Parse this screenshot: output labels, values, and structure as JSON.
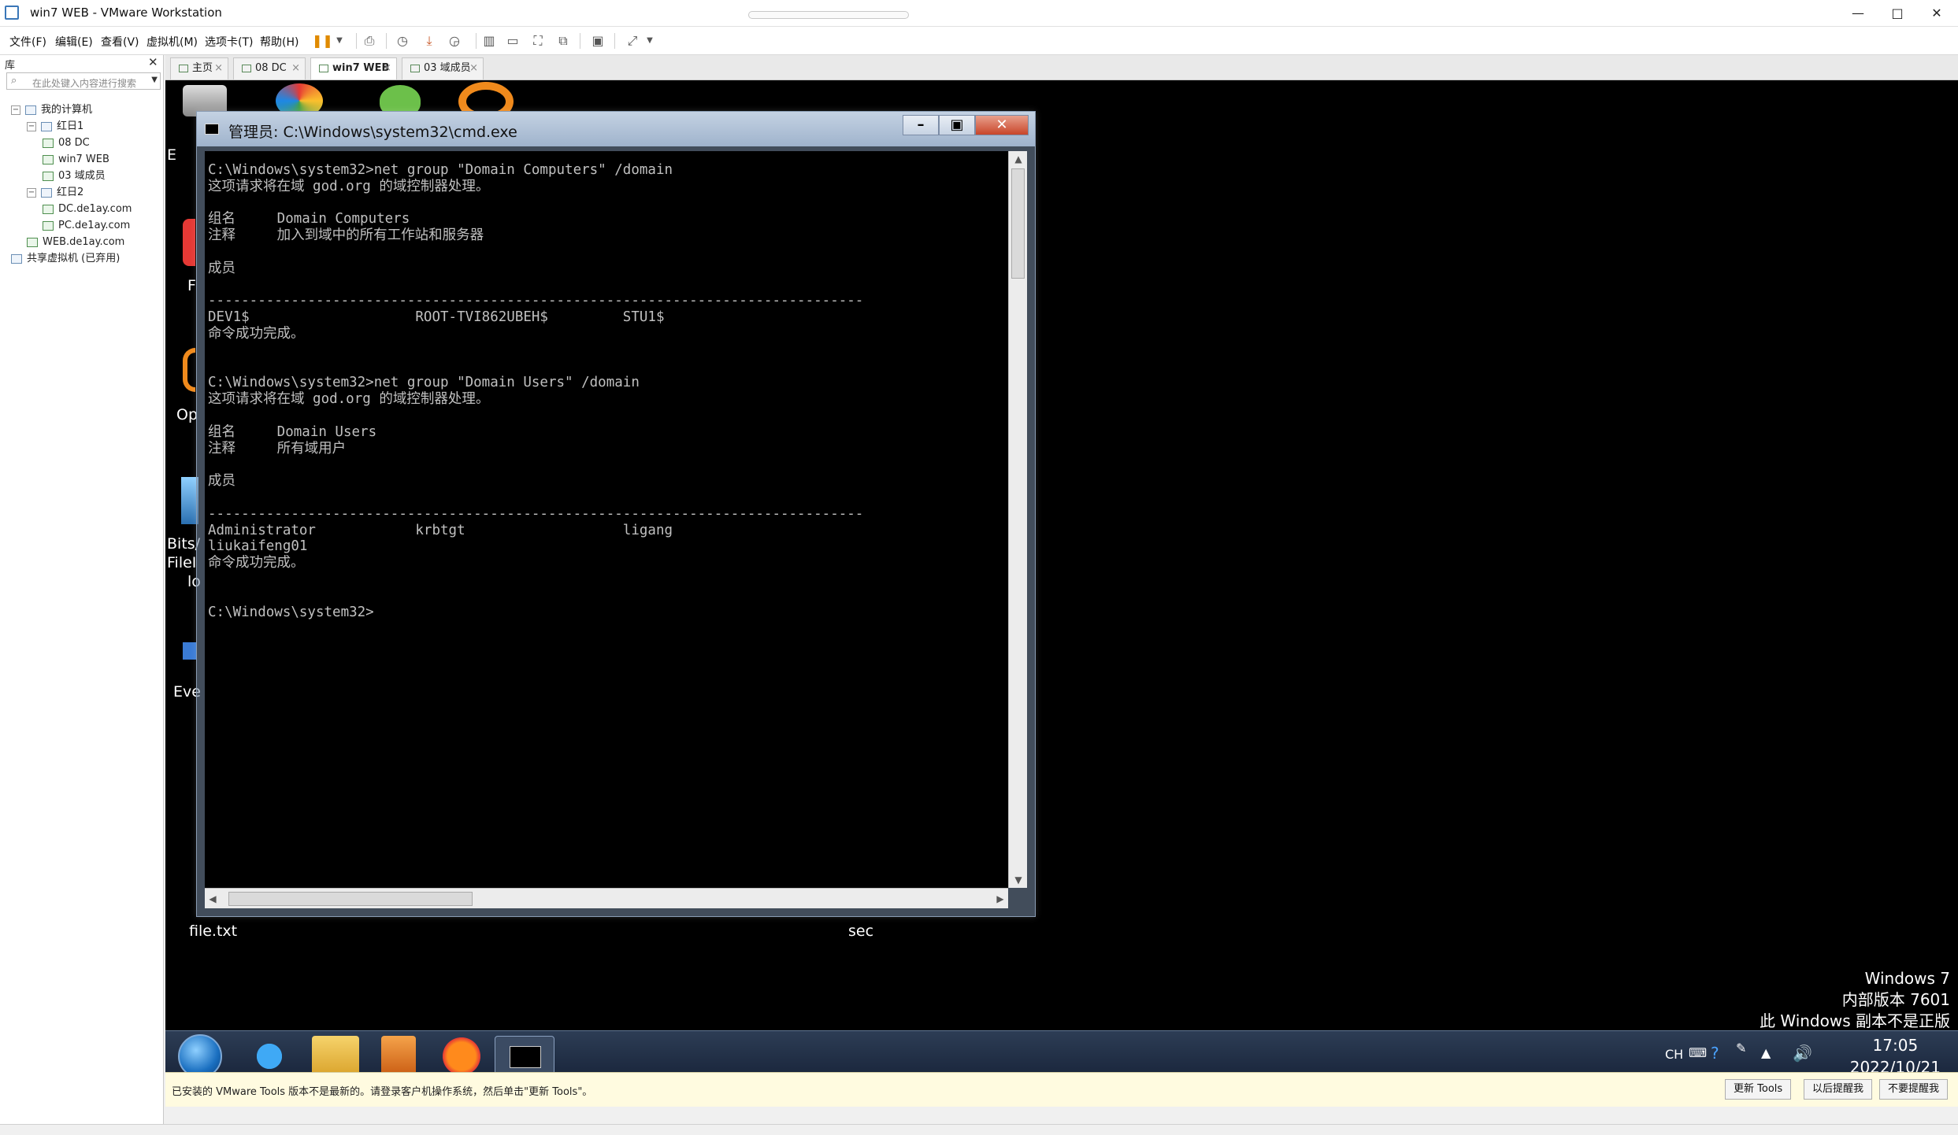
{
  "host": {
    "title": "win7 WEB - VMware Workstation",
    "menu": [
      "文件(F)",
      "编辑(E)",
      "查看(V)",
      "虚拟机(M)",
      "选项卡(T)",
      "帮助(H)"
    ]
  },
  "library": {
    "title": "库",
    "search_placeholder": "在此处键入内容进行搜索",
    "tree": [
      {
        "label": "我的计算机",
        "level": 0,
        "expander": "−",
        "kind": "computer"
      },
      {
        "label": "红日1",
        "level": 1,
        "expander": "−",
        "kind": "folder"
      },
      {
        "label": "08 DC",
        "level": 2,
        "kind": "vm"
      },
      {
        "label": "win7 WEB",
        "level": 2,
        "kind": "vm"
      },
      {
        "label": "03 域成员",
        "level": 2,
        "kind": "vm"
      },
      {
        "label": "红日2",
        "level": 1,
        "expander": "−",
        "kind": "folder"
      },
      {
        "label": "DC.de1ay.com",
        "level": 2,
        "kind": "vm"
      },
      {
        "label": "PC.de1ay.com",
        "level": 2,
        "kind": "vm"
      },
      {
        "label": "WEB.de1ay.com",
        "level": 1,
        "kind": "vm"
      },
      {
        "label": "共享虚拟机 (已弃用)",
        "level": 0,
        "kind": "shared"
      }
    ]
  },
  "tabs": [
    {
      "label": "主页",
      "active": false
    },
    {
      "label": "08 DC",
      "active": false
    },
    {
      "label": "win7 WEB",
      "active": true
    },
    {
      "label": "03 域成员",
      "active": false
    }
  ],
  "desktop": {
    "labels": [
      "file.txt",
      "sec",
      "Bits/",
      "FileI",
      "lo",
      "Eve",
      "Op",
      "F",
      "E"
    ],
    "watermark": [
      "Windows 7",
      "内部版本 7601",
      "此 Windows 副本不是正版"
    ]
  },
  "cmd": {
    "title": "管理员: C:\\Windows\\system32\\cmd.exe",
    "lines": [
      "C:\\Windows\\system32>net group \"Domain Computers\" /domain",
      "这项请求将在域 god.org 的域控制器处理。",
      "",
      "组名     Domain Computers",
      "注释     加入到域中的所有工作站和服务器",
      "",
      "成员",
      "",
      "-------------------------------------------------------------------------------",
      "DEV1$                    ROOT-TVI862UBEH$         STU1$",
      "命令成功完成。",
      "",
      "",
      "C:\\Windows\\system32>net group \"Domain Users\" /domain",
      "这项请求将在域 god.org 的域控制器处理。",
      "",
      "组名     Domain Users",
      "注释     所有域用户",
      "",
      "成员",
      "",
      "-------------------------------------------------------------------------------",
      "Administrator            krbtgt                   ligang",
      "liukaifeng01",
      "命令成功完成。",
      "",
      "",
      "C:\\Windows\\system32>"
    ]
  },
  "taskbar": {
    "lang": "CH",
    "time": "17:05",
    "date": "2022/10/21"
  },
  "tools": {
    "message": "已安装的 VMware Tools 版本不是最新的。请登录客户机操作系统，然后单击\"更新 Tools\"。",
    "buttons": [
      "更新 Tools",
      "以后提醒我",
      "不要提醒我"
    ]
  },
  "colors": {
    "guest_bg": "#000000",
    "console_text": "#c0c0c0",
    "taskbar": "#1f2d44",
    "tools_bar": "#fffbe0"
  }
}
